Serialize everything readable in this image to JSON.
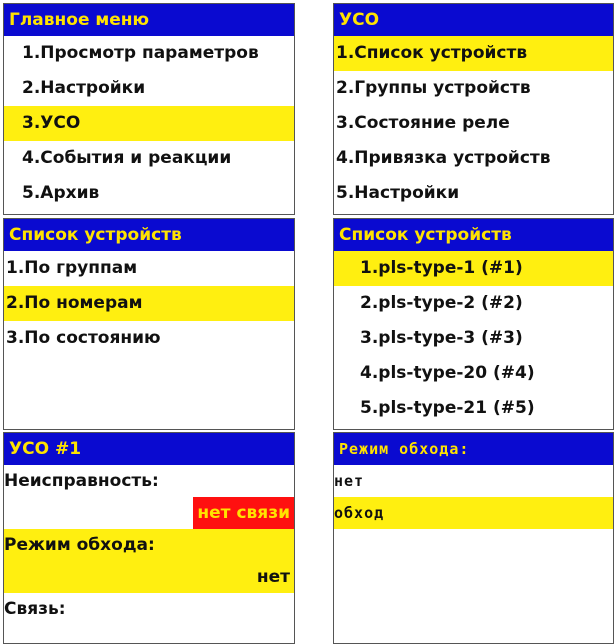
{
  "main_menu": {
    "title": "Главное меню",
    "items": [
      "1.Просмотр параметров",
      "2.Настройки",
      "3.УСО",
      "4.События и реакции",
      "5.Архив"
    ],
    "selected": 2
  },
  "uso_menu": {
    "title": "УСО",
    "items": [
      "1.Список устройств",
      "2.Группы устройств",
      "3.Состояние реле",
      "4.Привязка устройств",
      "5.Настройки"
    ],
    "selected": 0
  },
  "device_list_menu": {
    "title": "Список устройств",
    "items": [
      "1.По группам",
      "2.По номерам",
      "3.По состоянию"
    ],
    "selected": 1
  },
  "device_list": {
    "title": "Список устройств",
    "items": [
      "1.pls-type-1 (#1)",
      "2.pls-type-2 (#2)",
      "3.pls-type-3 (#3)",
      "4.pls-type-20 (#4)",
      "5.pls-type-21 (#5)"
    ],
    "selected": 0
  },
  "uso_device": {
    "title": "УСО #1",
    "fault_label": "Неисправность:",
    "fault_value": "нет связи",
    "bypass_label": "Режим обхода:",
    "bypass_value": "нет",
    "link_label": "Связь:"
  },
  "bypass_mode": {
    "title": "Режим обхода:",
    "options": [
      "нет",
      "обход"
    ],
    "selected": 1
  },
  "colors": {
    "title_bg": "#0a0ad0",
    "title_text": "#ffe300",
    "highlight": "#ffef10",
    "alert": "#ff1010"
  }
}
